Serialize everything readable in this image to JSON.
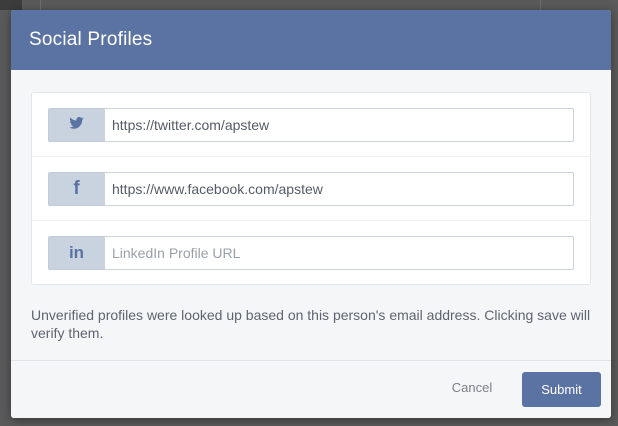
{
  "modal": {
    "title": "Social Profiles"
  },
  "profiles": [
    {
      "network": "twitter",
      "icon": "twitter-bird-icon",
      "value": "https://twitter.com/apstew",
      "placeholder": ""
    },
    {
      "network": "facebook",
      "icon": "facebook-f-icon",
      "value": "https://www.facebook.com/apstew",
      "placeholder": ""
    },
    {
      "network": "linkedin",
      "icon": "linkedin-in-icon",
      "value": "",
      "placeholder": "LinkedIn Profile URL"
    }
  ],
  "icons": {
    "facebook_glyph": "f",
    "linkedin_glyph": "in"
  },
  "info": {
    "text": "Unverified profiles were looked up based on this person's email address. Clicking save will verify them."
  },
  "footer": {
    "cancel_label": "Cancel",
    "submit_label": "Submit"
  },
  "colors": {
    "accent": "#5b73a3",
    "icon_bg": "#c9d3e0"
  }
}
